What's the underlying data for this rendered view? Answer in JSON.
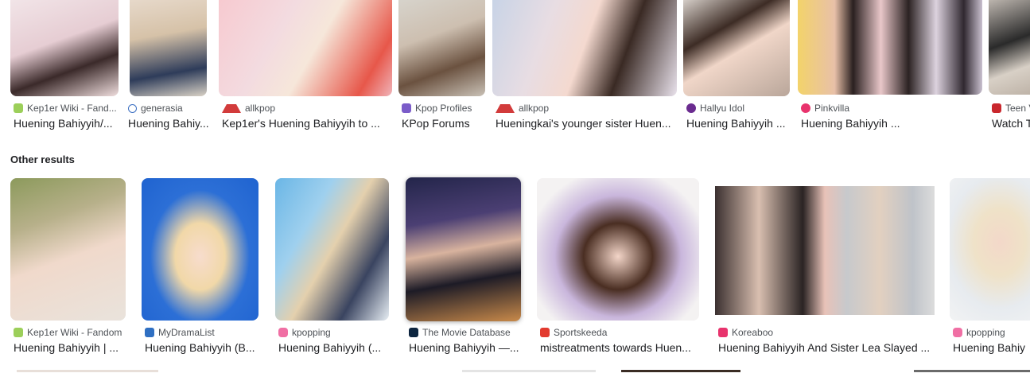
{
  "top_row": [
    {
      "source": "Kep1er Wiki - Fand...",
      "title": "Huening Bahiyyih/...",
      "icon": "kep1er-wiki-favicon",
      "color": "#9ccf5a"
    },
    {
      "source": "generasia",
      "title": "Huening Bahiy...",
      "icon": "generasia-favicon",
      "color": "#3b6fc2"
    },
    {
      "source": "allkpop",
      "title": "Kep1er's Huening Bahiyyih to ...",
      "icon": "allkpop-favicon",
      "color": "#d23b3b"
    },
    {
      "source": "Kpop Profiles",
      "title": "KPop Forums",
      "icon": "kpop-profiles-favicon",
      "color": "#7b5cc9"
    },
    {
      "source": "allkpop",
      "title": "Hueningkai's younger sister Huen...",
      "icon": "allkpop-favicon",
      "color": "#d23b3b"
    },
    {
      "source": "Hallyu Idol",
      "title": "Huening Bahiyyih ...",
      "icon": "hallyu-idol-favicon",
      "color": "#6a2b8f"
    },
    {
      "source": "Pinkvilla",
      "title": "Huening Bahiyyih ...",
      "icon": "pinkvilla-favicon",
      "color": "#e8336d"
    },
    {
      "source": "Teen V",
      "title": "Watch T",
      "icon": "teen-vogue-favicon",
      "color": "#c9272d"
    }
  ],
  "section": {
    "heading": "Other results"
  },
  "other_row": [
    {
      "source": "Kep1er Wiki - Fandom",
      "title": "Huening Bahiyyih | ...",
      "icon": "kep1er-wiki-favicon",
      "color": "#9ccf5a"
    },
    {
      "source": "MyDramaList",
      "title": "Huening Bahiyyih (B...",
      "icon": "mydramalist-favicon",
      "color": "#2f6fc2"
    },
    {
      "source": "kpopping",
      "title": "Huening Bahiyyih (...",
      "icon": "kpopping-favicon",
      "color": "#f06fa4"
    },
    {
      "source": "The Movie Database",
      "title": "Huening Bahiyyih —...",
      "icon": "tmdb-favicon",
      "color": "#0d253f"
    },
    {
      "source": "Sportskeeda",
      "title": "mistreatments towards Huen...",
      "icon": "sportskeeda-favicon",
      "color": "#e23a2f"
    },
    {
      "source": "Koreaboo",
      "title": "Huening Bahiyyih And Sister Lea Slayed ...",
      "icon": "koreaboo-favicon",
      "color": "#e8336d"
    },
    {
      "source": "kpopping",
      "title": "Huening Bahiy",
      "icon": "kpopping-favicon",
      "color": "#f06fa4"
    }
  ]
}
